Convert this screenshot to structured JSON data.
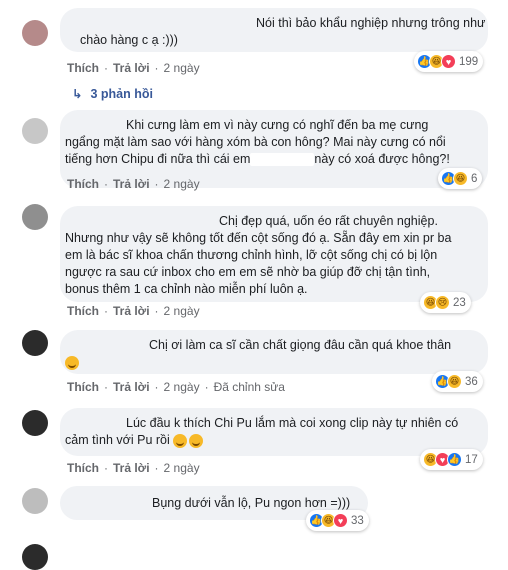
{
  "comments": [
    {
      "lines": [
        "Nói thì bảo khẩu nghiệp nhưng trông như",
        "chào hàng c ạ :)))"
      ],
      "time": "2 ngày",
      "react_count": "199"
    },
    {
      "lines": [
        "Khi cưng làm em vì này cưng có nghĩ đến ba mẹ cưng",
        "ngẩng mặt làm sao với hàng xóm bà con hông? Mai này cưng có nổi",
        "tiếng hơn Chipu đi nữa thì cái em",
        "này có xoá được hông?!"
      ],
      "time": "2 ngày",
      "react_count": "6"
    },
    {
      "lines": [
        "Chị đẹp quá, uốn éo rất chuyên nghiệp.",
        "Nhưng như vậy sẽ không tốt đến cột sống đó ạ. Sẵn đây em xin pr ba",
        "em là bác sĩ khoa chấn thương chỉnh hình, lỡ cột sống chị có bị lộn",
        "ngược ra sau cứ inbox cho em em sẽ nhờ ba giúp đỡ chị tận tình,",
        "bonus thêm 1 ca chỉnh nào miễn phí luôn ạ."
      ],
      "time": "2 ngày",
      "react_count": "23"
    },
    {
      "lines": [
        "Chị ơi làm ca sĩ cần chất giọng đâu cần quá khoe thân"
      ],
      "time": "2 ngày",
      "edited": "Đã chỉnh sửa",
      "react_count": "36"
    },
    {
      "lines": [
        "Lúc đầu k thích Chi Pu lắm mà coi xong clip này tự nhiên có",
        "cảm tình với Pu rồi"
      ],
      "time": "2 ngày",
      "react_count": "17"
    },
    {
      "lines": [
        "Bụng dưới vẫn lộ, Pu ngon hơn =)))"
      ],
      "react_count": "33"
    }
  ],
  "actions": {
    "like": "Thích",
    "reply": "Trả lời",
    "sep": "·"
  },
  "replies_label": "3 phản hồi"
}
